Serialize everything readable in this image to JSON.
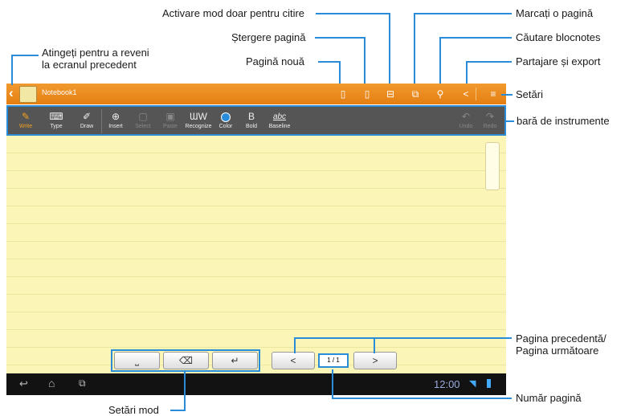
{
  "device": {
    "title": "Notebook1",
    "toolbar": [
      {
        "label": "Write",
        "icon": "pen-icon"
      },
      {
        "label": "Type",
        "icon": "keyboard-icon"
      },
      {
        "label": "Draw",
        "icon": "brush-icon"
      },
      {
        "label": "Insert",
        "icon": "insert-icon"
      },
      {
        "label": "Select",
        "icon": "select-icon"
      },
      {
        "label": "Paste",
        "icon": "paste-icon"
      },
      {
        "label": "Recognize",
        "icon": "recognize-icon"
      },
      {
        "label": "Color",
        "icon": "color-icon"
      },
      {
        "label": "Bold",
        "icon": "bold-icon"
      },
      {
        "label": "Baseline",
        "icon": "baseline-icon"
      },
      {
        "label": "Undo",
        "icon": "undo-icon"
      },
      {
        "label": "Redo",
        "icon": "redo-icon"
      }
    ],
    "recognize_glyph": "ƜW",
    "bold_glyph": "B",
    "baseline_glyph": "abc",
    "page_indicator": "1 / 1",
    "prev_glyph": "<",
    "next_glyph": ">",
    "clock": "12:00",
    "accent_color": "#e47e12",
    "paper_color": "#fbf6b7"
  },
  "callouts": {
    "back": "Atingeți pentru a reveni\nla ecranul precedent",
    "read_only": "Activare mod doar pentru citire",
    "delete_page": "Ștergere pagină",
    "new_page": "Pagină nouă",
    "bookmark": "Marcați o pagină",
    "search": "Căutare blocnotes",
    "share": "Partajare și export",
    "settings": "Setări",
    "toolbar": "bară de instrumente",
    "prev_next": "Pagina precedentă/\nPagina următoare",
    "page_number": "Număr pagină",
    "mode_settings": "Setări mod"
  }
}
